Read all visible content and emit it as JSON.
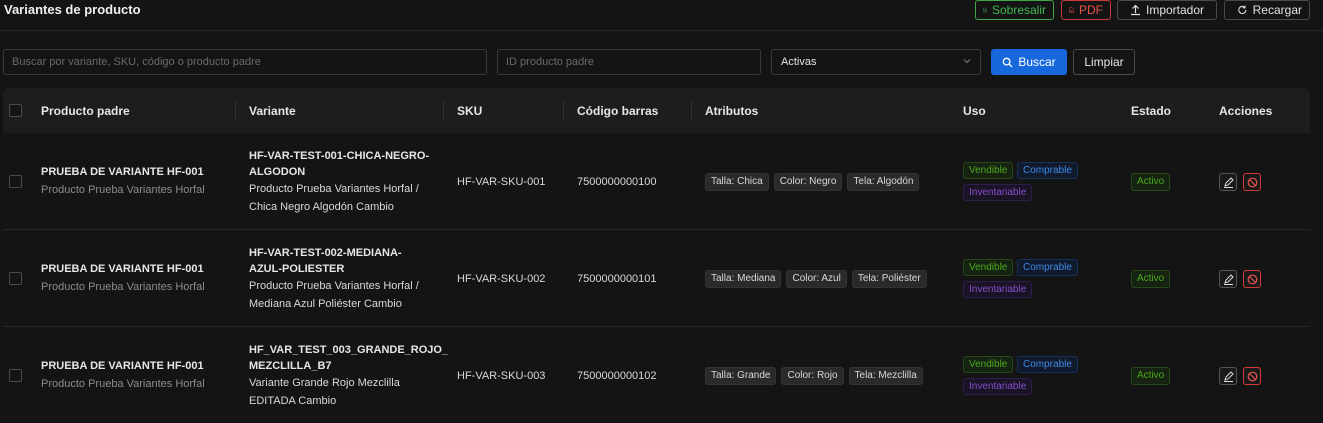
{
  "header": {
    "title": "Variantes de producto",
    "excel_label": "Sobresalir",
    "pdf_label": "PDF",
    "import_label": "Importador",
    "reload_label": "Recargar"
  },
  "filters": {
    "search_placeholder": "Buscar por variante, SKU, código o producto padre",
    "parent_placeholder": "ID producto padre",
    "status_value": "Activas",
    "search_button": "Buscar",
    "clear_button": "Limpiar"
  },
  "table": {
    "columns": [
      "Producto padre",
      "Variante",
      "SKU",
      "Código barras",
      "Atributos",
      "Uso",
      "Estado",
      "Acciones"
    ],
    "rows": [
      {
        "parent_name": "PRUEBA DE VARIANTE HF-001",
        "parent_sub": "Producto Prueba Variantes Horfal",
        "variant_code_1": "HF-VAR-TEST-001-CHICA-NEGRO-",
        "variant_code_2": "ALGODON",
        "variant_desc_1": "Producto Prueba Variantes Horfal /",
        "variant_desc_2": "Chica Negro Algodón Cambio",
        "sku": "HF-VAR-SKU-001",
        "barcode": "7500000000100",
        "attributes": [
          "Talla: Chica",
          "Color: Negro",
          "Tela: Algodón"
        ],
        "uso": [
          "Vendible",
          "Comprable",
          "Inventariable"
        ],
        "status": "Activo"
      },
      {
        "parent_name": "PRUEBA DE VARIANTE HF-001",
        "parent_sub": "Producto Prueba Variantes Horfal",
        "variant_code_1": "HF-VAR-TEST-002-MEDIANA-",
        "variant_code_2": "AZUL-POLIESTER",
        "variant_desc_1": "Producto Prueba Variantes Horfal /",
        "variant_desc_2": "Mediana Azul Poliéster Cambio",
        "sku": "HF-VAR-SKU-002",
        "barcode": "7500000000101",
        "attributes": [
          "Talla: Mediana",
          "Color: Azul",
          "Tela: Poliéster"
        ],
        "uso": [
          "Vendible",
          "Comprable",
          "Inventariable"
        ],
        "status": "Activo"
      },
      {
        "parent_name": "PRUEBA DE VARIANTE HF-001",
        "parent_sub": "Producto Prueba Variantes Horfal",
        "variant_code_1": "HF_VAR_TEST_003_GRANDE_ROJO_",
        "variant_code_2": "MEZCLILLA_B7",
        "variant_desc_1": "Variante Grande Rojo Mezclilla",
        "variant_desc_2": "EDITADA Cambio",
        "sku": "HF-VAR-SKU-003",
        "barcode": "7500000000102",
        "attributes": [
          "Talla: Grande",
          "Color: Rojo",
          "Tela: Mezclilla"
        ],
        "uso": [
          "Vendible",
          "Comprable",
          "Inventariable"
        ],
        "status": "Activo"
      }
    ]
  }
}
